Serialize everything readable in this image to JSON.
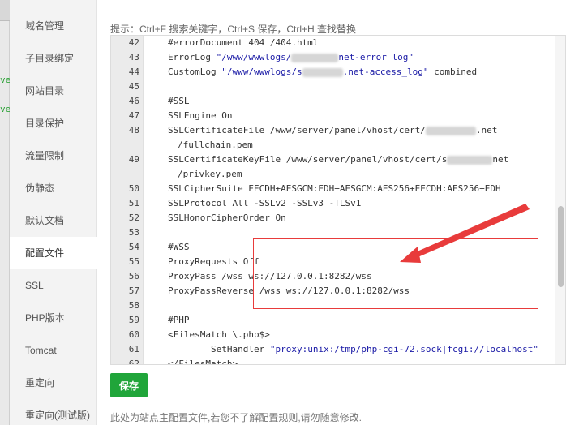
{
  "sidebar": {
    "items": [
      {
        "label": "域名管理"
      },
      {
        "label": "子目录绑定"
      },
      {
        "label": "网站目录"
      },
      {
        "label": "目录保护"
      },
      {
        "label": "流量限制"
      },
      {
        "label": "伪静态"
      },
      {
        "label": "默认文档"
      },
      {
        "label": "配置文件",
        "active": true
      },
      {
        "label": "SSL"
      },
      {
        "label": "PHP版本"
      },
      {
        "label": "Tomcat"
      },
      {
        "label": "重定向"
      },
      {
        "label": "重定向(测试版)"
      }
    ]
  },
  "main": {
    "tip": "提示：Ctrl+F 搜索关键字，Ctrl+S 保存，Ctrl+H 查找替换",
    "save_label": "保存",
    "footer_note": "此处为站点主配置文件,若您不了解配置规则,请勿随意修改."
  },
  "editor": {
    "lines": [
      {
        "n": "42",
        "code": "#errorDocument 404 /404.html"
      },
      {
        "n": "43",
        "pre": "ErrorLog ",
        "str1": "\"/www/wwwlogs/",
        "str2": "net-error_log\""
      },
      {
        "n": "44",
        "pre": "CustomLog ",
        "str1": "\"/www/wwwlogs/s",
        "str2": ".net-access_log\"",
        "post": " combined"
      },
      {
        "n": "45",
        "code": ""
      },
      {
        "n": "46",
        "code": "#SSL"
      },
      {
        "n": "47",
        "code": "SSLEngine On"
      },
      {
        "n": "48",
        "code": "SSLCertificateFile /www/server/panel/vhost/cert/",
        "tail": ".net",
        "wrap": "/fullchain.pem"
      },
      {
        "n": "49",
        "code": "SSLCertificateKeyFile /www/server/panel/vhost/cert/s",
        "tail": "net",
        "wrap": "/privkey.pem"
      },
      {
        "n": "50",
        "code": "SSLCipherSuite EECDH+AESGCM:EDH+AESGCM:AES256+EECDH:AES256+EDH"
      },
      {
        "n": "51",
        "code": "SSLProtocol All -SSLv2 -SSLv3 -TLSv1"
      },
      {
        "n": "52",
        "code": "SSLHonorCipherOrder On"
      },
      {
        "n": "53",
        "code": ""
      },
      {
        "n": "54",
        "code": "#WSS"
      },
      {
        "n": "55",
        "code": "ProxyRequests Off"
      },
      {
        "n": "56",
        "code": "ProxyPass /wss ws://127.0.0.1:8282/wss"
      },
      {
        "n": "57",
        "code": "ProxyPassReverse /wss ws://127.0.0.1:8282/wss"
      },
      {
        "n": "58",
        "code": ""
      },
      {
        "n": "59",
        "code": "#PHP"
      },
      {
        "n": "60",
        "code": "<FilesMatch \\.php$>"
      },
      {
        "n": "61",
        "pre": "        SetHandler ",
        "str1": "\"proxy:unix:/tmp/php-cgi-72.sock|fcgi://localhost\""
      },
      {
        "n": "62",
        "code": "</FilesMatch>"
      }
    ]
  },
  "colors": {
    "save_button": "#20a53a",
    "highlight_border": "#e83b3b",
    "arrow": "#e83b3b",
    "string_text": "#1a1aa6"
  }
}
